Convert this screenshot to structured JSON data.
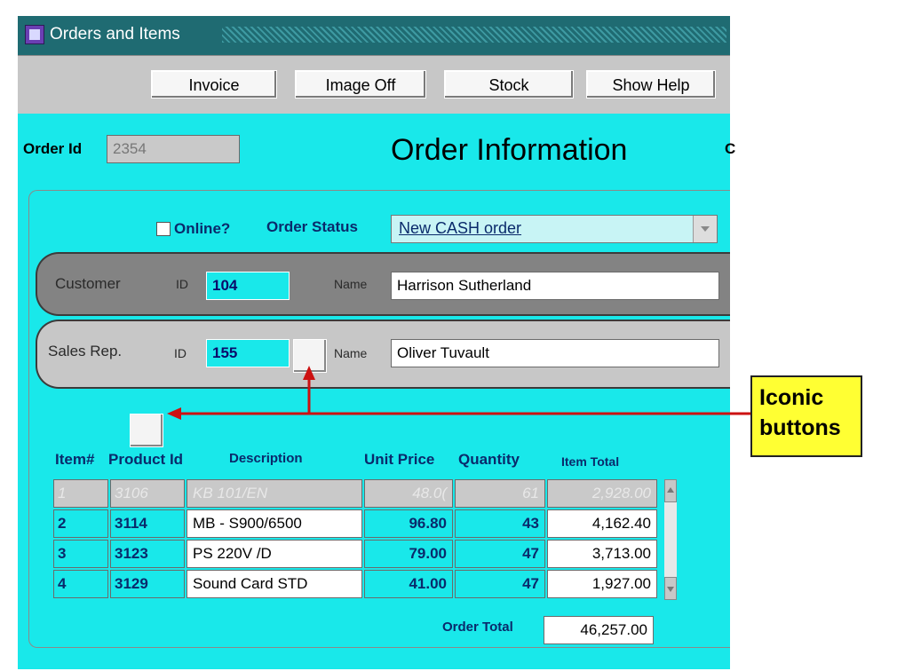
{
  "window": {
    "title": "Orders and Items"
  },
  "toolbar": {
    "buttons": [
      "Invoice",
      "Image Off",
      "Stock",
      "Show Help"
    ]
  },
  "order": {
    "id_label": "Order Id",
    "id_value": "2354",
    "heading": "Order Information",
    "heading_cut": "C",
    "online_label": "Online?",
    "status_label": "Order Status",
    "status_value": "New CASH order"
  },
  "customer": {
    "label": "Customer",
    "id_label": "ID",
    "id_value": "104",
    "name_label": "Name",
    "name_value": "Harrison Sutherland"
  },
  "sales_rep": {
    "label": "Sales Rep.",
    "id_label": "ID",
    "id_value": "155",
    "name_label": "Name",
    "name_value": "Oliver Tuvault"
  },
  "items": {
    "headers": [
      "Item#",
      "Product Id",
      "Description",
      "Unit Price",
      "Quantity",
      "Item Total"
    ],
    "rows": [
      {
        "item": "1",
        "product": "3106",
        "description": "KB 101/EN",
        "price": "48.0(",
        "qty": "61",
        "total": "2,928.00"
      },
      {
        "item": "2",
        "product": "3114",
        "description": "MB - S900/6500",
        "price": "96.80",
        "qty": "43",
        "total": "4,162.40"
      },
      {
        "item": "3",
        "product": "3123",
        "description": "PS 220V /D",
        "price": "79.00",
        "qty": "47",
        "total": "3,713.00"
      },
      {
        "item": "4",
        "product": "3129",
        "description": "Sound Card STD",
        "price": "41.00",
        "qty": "47",
        "total": "1,927.00"
      }
    ],
    "order_total_label": "Order Total",
    "order_total_value": "46,257.00"
  },
  "annotation": {
    "line1": "Iconic",
    "line2": "buttons",
    "arrow_color": "#cc1111"
  },
  "colors": {
    "form_bg": "#19e8ea",
    "title_bar": "#1f6b72",
    "callout_bg": "#ffff33"
  }
}
